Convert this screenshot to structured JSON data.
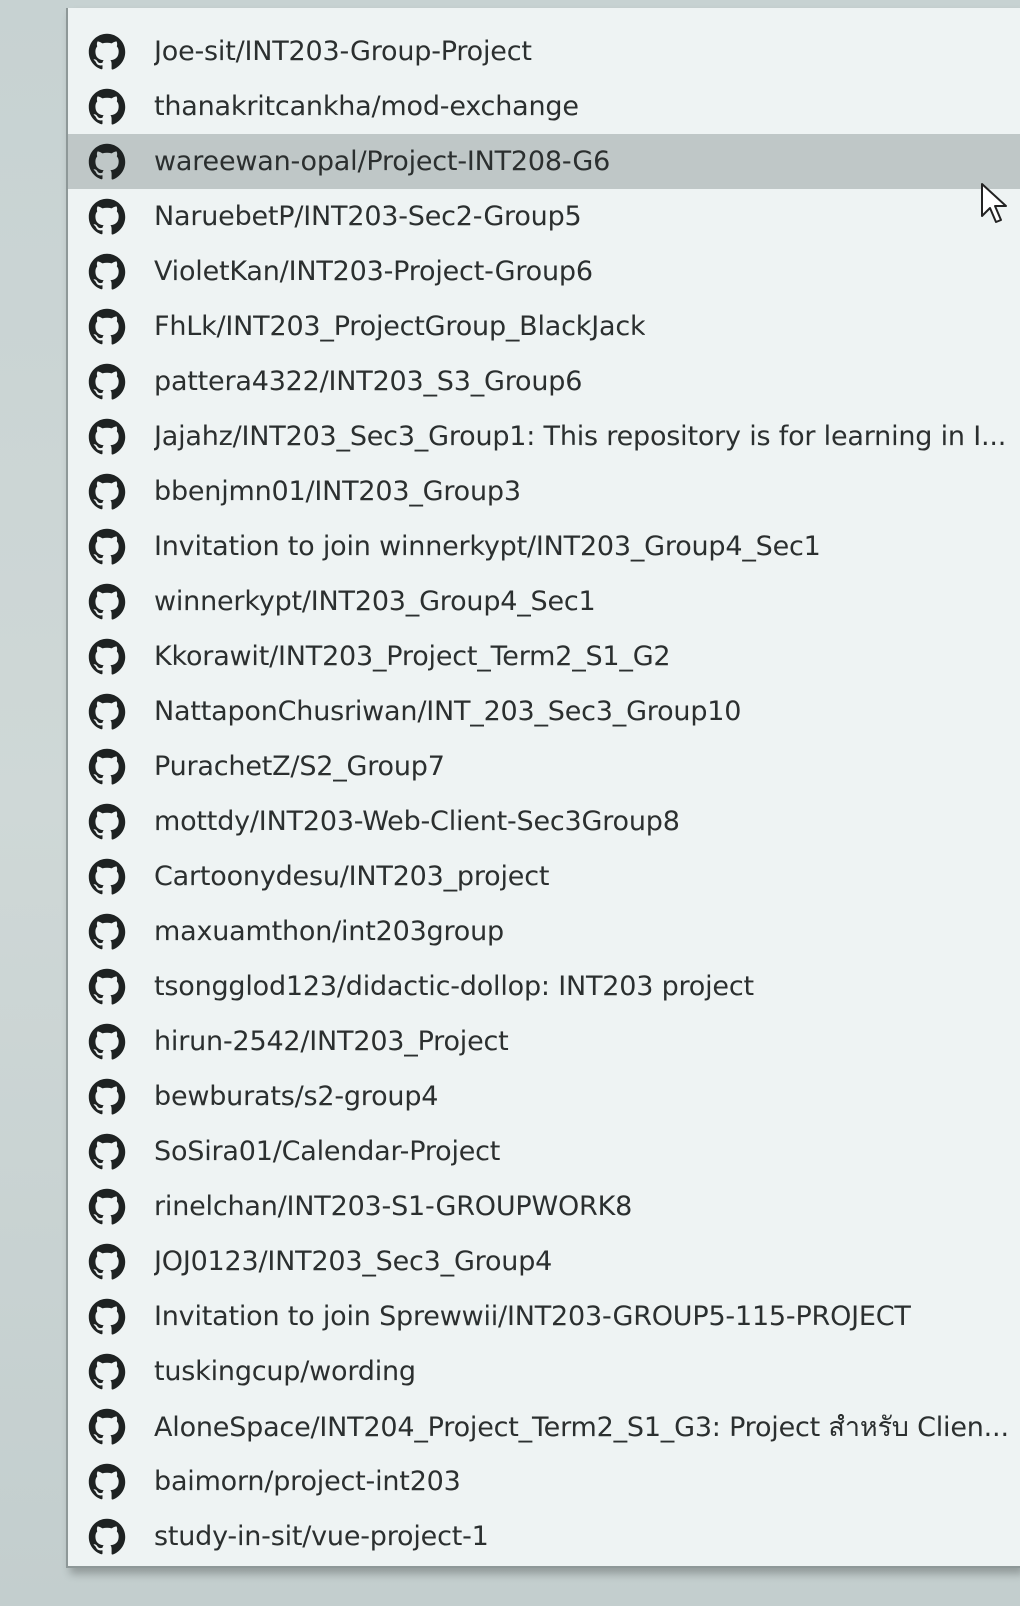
{
  "dropdown": {
    "selected_index": 2,
    "items": [
      {
        "label": "Joe-sit/INT203-Group-Project",
        "icon": "github-icon"
      },
      {
        "label": "thanakritcankha/mod-exchange",
        "icon": "github-icon"
      },
      {
        "label": "wareewan-opal/Project-INT208-G6",
        "icon": "github-icon"
      },
      {
        "label": "NaruebetP/INT203-Sec2-Group5",
        "icon": "github-icon"
      },
      {
        "label": "VioletKan/INT203-Project-Group6",
        "icon": "github-icon"
      },
      {
        "label": "FhLk/INT203_ProjectGroup_BlackJack",
        "icon": "github-icon"
      },
      {
        "label": "pattera4322/INT203_S3_Group6",
        "icon": "github-icon"
      },
      {
        "label": "Jajahz/INT203_Sec3_Group1: This repository is for learning in I...",
        "icon": "github-icon"
      },
      {
        "label": "bbenjmn01/INT203_Group3",
        "icon": "github-icon"
      },
      {
        "label": "Invitation to join winnerkypt/INT203_Group4_Sec1",
        "icon": "github-icon"
      },
      {
        "label": "winnerkypt/INT203_Group4_Sec1",
        "icon": "github-icon"
      },
      {
        "label": "Kkorawit/INT203_Project_Term2_S1_G2",
        "icon": "github-icon"
      },
      {
        "label": "NattaponChusriwan/INT_203_Sec3_Group10",
        "icon": "github-icon"
      },
      {
        "label": "PurachetZ/S2_Group7",
        "icon": "github-icon"
      },
      {
        "label": "mottdy/INT203-Web-Client-Sec3Group8",
        "icon": "github-icon"
      },
      {
        "label": "Cartoonydesu/INT203_project",
        "icon": "github-icon"
      },
      {
        "label": "maxuamthon/int203group",
        "icon": "github-icon"
      },
      {
        "label": "tsongglod123/didactic-dollop: INT203 project",
        "icon": "github-icon"
      },
      {
        "label": "hirun-2542/INT203_Project",
        "icon": "github-icon"
      },
      {
        "label": "bewburats/s2-group4",
        "icon": "github-icon"
      },
      {
        "label": "SoSira01/Calendar-Project",
        "icon": "github-icon"
      },
      {
        "label": "rinelchan/INT203-S1-GROUPWORK8",
        "icon": "github-icon"
      },
      {
        "label": "JOJ0123/INT203_Sec3_Group4",
        "icon": "github-icon"
      },
      {
        "label": "Invitation to join Sprewwii/INT203-GROUP5-115-PROJECT",
        "icon": "github-icon"
      },
      {
        "label": "tuskingcup/wording",
        "icon": "github-icon"
      },
      {
        "label": "AloneSpace/INT204_Project_Term2_S1_G3: Project สำหรับ Clien...",
        "icon": "github-icon"
      },
      {
        "label": "baimorn/project-int203",
        "icon": "github-icon"
      },
      {
        "label": "study-in-sit/vue-project-1",
        "icon": "github-icon"
      }
    ]
  },
  "colors": {
    "selected_row": "#bfc7c7",
    "text": "#2b2f2f",
    "icon": "#1e2222"
  },
  "cursor_icon": "mouse-pointer-icon"
}
